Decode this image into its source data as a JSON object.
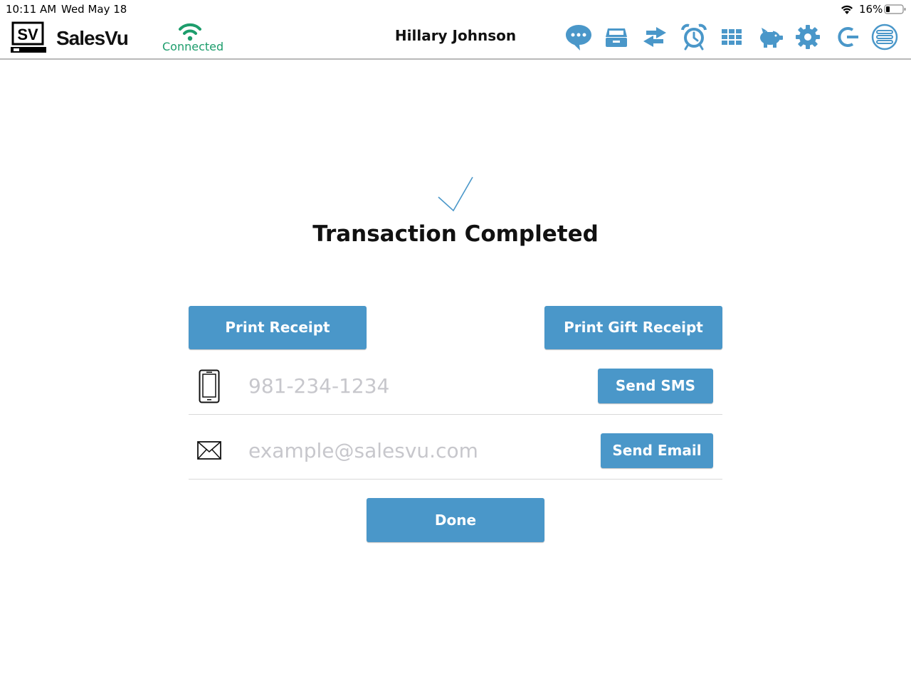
{
  "status_bar": {
    "time": "10:11 AM",
    "date": "Wed May 18",
    "battery_percent": "16%",
    "battery_level": 0.16
  },
  "header": {
    "brand": "SalesVu",
    "logo_text": "SV",
    "connection_status": "Connected",
    "user_name": "Hillary Johnson",
    "icons": [
      "chat-icon",
      "cash-drawer-icon",
      "transfer-arrows-icon",
      "alarm-clock-icon",
      "grid-icon",
      "piggy-bank-icon",
      "gear-icon",
      "logout-icon",
      "menu-list-icon"
    ]
  },
  "main": {
    "title": "Transaction Completed",
    "print_receipt_label": "Print Receipt",
    "print_gift_receipt_label": "Print Gift Receipt",
    "phone_placeholder": "981-234-1234",
    "send_sms_label": "Send SMS",
    "email_placeholder": "example@salesvu.com",
    "send_email_label": "Send Email",
    "done_label": "Done"
  },
  "colors": {
    "accent": "#4a97c9",
    "connected": "#1d9d6c",
    "placeholder": "#c7c7cc"
  }
}
